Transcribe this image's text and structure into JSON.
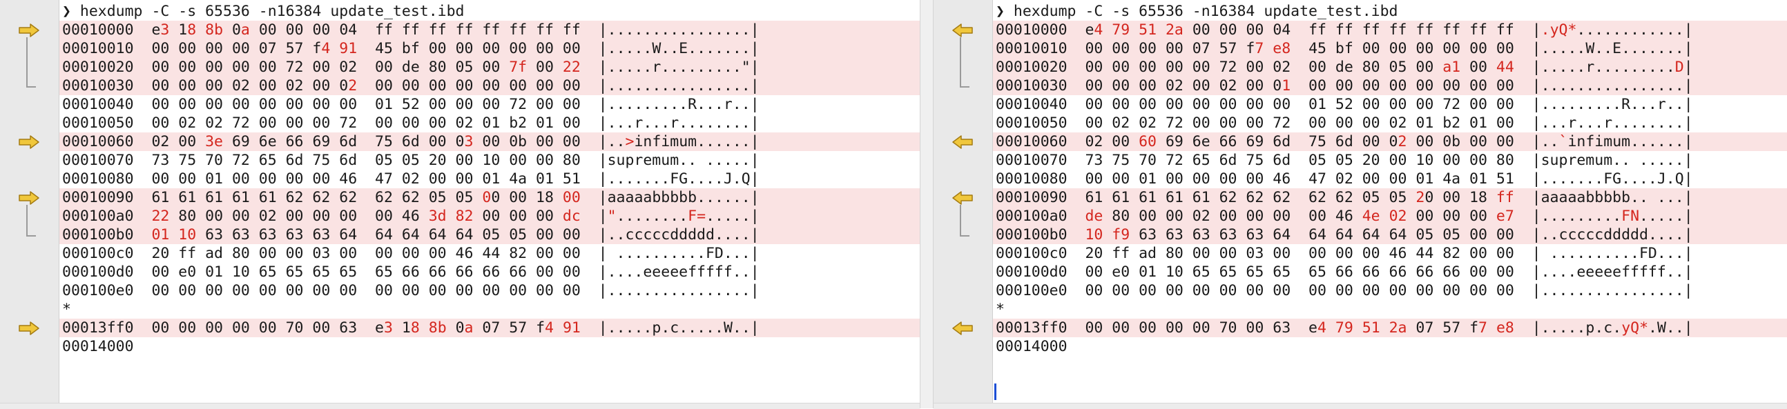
{
  "colors": {
    "diff_text": "#d4261e",
    "diff_row_bg": "#fae3e3",
    "arrow_fill": "#f0c73c",
    "arrow_stroke": "#a47b12",
    "gutter_bg": "#e9e9e9"
  },
  "left": {
    "command": "❯ hexdump -C -s 65536 -n16384 update_test.ibd",
    "rows": [
      {
        "hl": true,
        "segs": [
          [
            "00010000  e",
            0
          ],
          [
            "3",
            1
          ],
          [
            " 1",
            0
          ],
          [
            "8",
            1
          ],
          [
            " ",
            0
          ],
          [
            "8b",
            1
          ],
          [
            " 0",
            0
          ],
          [
            "a",
            1
          ],
          [
            " 00 00 00 04  ff ff ff ff ff ff ff ff  |................|",
            0
          ]
        ]
      },
      {
        "hl": true,
        "segs": [
          [
            "00010010  00 00 00 00 07 57 f",
            0
          ],
          [
            "4",
            1
          ],
          [
            " ",
            0
          ],
          [
            "91",
            1
          ],
          [
            "  45 bf 00 00 00 00 00 00  |.....W..E.......|",
            0
          ]
        ]
      },
      {
        "hl": true,
        "segs": [
          [
            "00010020  00 00 00 00 00 72 00 02  00 de 80 05 00 ",
            0
          ],
          [
            "7f",
            1
          ],
          [
            " 00 ",
            0
          ],
          [
            "22",
            1
          ],
          [
            "  |.....r.........\"|",
            0
          ]
        ]
      },
      {
        "hl": true,
        "segs": [
          [
            "00010030  00 00 00 02 00 02 00 0",
            0
          ],
          [
            "2",
            1
          ],
          [
            "  00 00 00 00 00 00 00 00  |................|",
            0
          ]
        ]
      },
      {
        "hl": false,
        "segs": [
          [
            "00010040  00 00 00 00 00 00 00 00  01 52 00 00 00 72 00 00  |.........R...r..|",
            0
          ]
        ]
      },
      {
        "hl": false,
        "segs": [
          [
            "00010050  00 02 02 72 00 00 00 72  00 00 00 02 01 b2 01 00  |...r...r........|",
            0
          ]
        ]
      },
      {
        "hl": true,
        "segs": [
          [
            "00010060  02 00 ",
            0
          ],
          [
            "3e",
            1
          ],
          [
            " 69 6e 66 69 6d  75 6d 00 0",
            0
          ],
          [
            "3",
            1
          ],
          [
            " 00 0b 00 00  |..",
            0
          ],
          [
            ">",
            1
          ],
          [
            "infimum......|",
            0
          ]
        ]
      },
      {
        "hl": false,
        "segs": [
          [
            "00010070  73 75 70 72 65 6d 75 6d  05 05 20 00 10 00 00 80  |supremum.. .....|",
            0
          ]
        ]
      },
      {
        "hl": false,
        "segs": [
          [
            "00010080  00 00 01 00 00 00 00 46  47 02 00 00 01 4a 01 51  |.......FG....J.Q|",
            0
          ]
        ]
      },
      {
        "hl": true,
        "segs": [
          [
            "00010090  61 61 61 61 61 62 62 62  62 62 05 05 ",
            0
          ],
          [
            "0",
            1
          ],
          [
            "0 00 18 ",
            0
          ],
          [
            "00",
            1
          ],
          [
            "  |aaaaabbbbb......|",
            0
          ]
        ]
      },
      {
        "hl": true,
        "segs": [
          [
            "000100a0  ",
            0
          ],
          [
            "22",
            1
          ],
          [
            " 80 00 00 02 00 00 00  00 46 ",
            0
          ],
          [
            "3d",
            1
          ],
          [
            " ",
            0
          ],
          [
            "82",
            1
          ],
          [
            " 00 00 00 ",
            0
          ],
          [
            "dc",
            1
          ],
          [
            "  |",
            0
          ],
          [
            "\"",
            1
          ],
          [
            "........",
            0
          ],
          [
            "F=",
            1
          ],
          [
            ".....|",
            0
          ]
        ]
      },
      {
        "hl": true,
        "segs": [
          [
            "000100b0  ",
            0
          ],
          [
            "01",
            1
          ],
          [
            " ",
            0
          ],
          [
            "10",
            1
          ],
          [
            " 63 63 63 63 63 64  64 64 64 64 05 05 00 00  |..cccccddddd....|",
            0
          ]
        ]
      },
      {
        "hl": false,
        "segs": [
          [
            "000100c0  20 ff ad 80 00 00 03 00  00 00 00 46 44 82 00 00  | ..........FD...|",
            0
          ]
        ]
      },
      {
        "hl": false,
        "segs": [
          [
            "000100d0  00 e0 01 10 65 65 65 65  65 66 66 66 66 66 00 00  |....eeeeefffff..|",
            0
          ]
        ]
      },
      {
        "hl": false,
        "segs": [
          [
            "000100e0  00 00 00 00 00 00 00 00  00 00 00 00 00 00 00 00  |................|",
            0
          ]
        ]
      },
      {
        "hl": false,
        "segs": [
          [
            "*",
            0
          ]
        ]
      },
      {
        "hl": true,
        "segs": [
          [
            "00013ff0  00 00 00 00 00 70 00 63  e",
            0
          ],
          [
            "3",
            1
          ],
          [
            " 1",
            0
          ],
          [
            "8",
            1
          ],
          [
            " ",
            0
          ],
          [
            "8b",
            1
          ],
          [
            " 0",
            0
          ],
          [
            "a",
            1
          ],
          [
            " 07 57 f",
            0
          ],
          [
            "4",
            1
          ],
          [
            " ",
            0
          ],
          [
            "91",
            1
          ],
          [
            "  |.....p.c.....W..|",
            0
          ]
        ]
      },
      {
        "hl": false,
        "segs": [
          [
            "00014000",
            0
          ]
        ]
      }
    ]
  },
  "right": {
    "command": "❯ hexdump -C -s 65536 -n16384 update_test.ibd",
    "rows": [
      {
        "hl": true,
        "segs": [
          [
            "00010000  e",
            0
          ],
          [
            "4",
            1
          ],
          [
            " ",
            0
          ],
          [
            "79",
            1
          ],
          [
            " ",
            0
          ],
          [
            "51",
            1
          ],
          [
            " ",
            0
          ],
          [
            "2a",
            1
          ],
          [
            " 00 00 00 04  ff ff ff ff ff ff ff ff  |",
            0
          ],
          [
            ".yQ*",
            1
          ],
          [
            "............|",
            0
          ]
        ]
      },
      {
        "hl": true,
        "segs": [
          [
            "00010010  00 00 00 00 07 57 f",
            0
          ],
          [
            "7",
            1
          ],
          [
            " ",
            0
          ],
          [
            "e8",
            1
          ],
          [
            "  45 bf 00 00 00 00 00 00  |.....W..E.......|",
            0
          ]
        ]
      },
      {
        "hl": true,
        "segs": [
          [
            "00010020  00 00 00 00 00 72 00 02  00 de 80 05 00 ",
            0
          ],
          [
            "a1",
            1
          ],
          [
            " 00 ",
            0
          ],
          [
            "44",
            1
          ],
          [
            "  |.....r.........",
            0
          ],
          [
            "D",
            1
          ],
          [
            "|",
            0
          ]
        ]
      },
      {
        "hl": true,
        "segs": [
          [
            "00010030  00 00 00 02 00 02 00 0",
            0
          ],
          [
            "1",
            1
          ],
          [
            "  00 00 00 00 00 00 00 00  |................|",
            0
          ]
        ]
      },
      {
        "hl": false,
        "segs": [
          [
            "00010040  00 00 00 00 00 00 00 00  01 52 00 00 00 72 00 00  |.........R...r..|",
            0
          ]
        ]
      },
      {
        "hl": false,
        "segs": [
          [
            "00010050  00 02 02 72 00 00 00 72  00 00 00 02 01 b2 01 00  |...r...r........|",
            0
          ]
        ]
      },
      {
        "hl": true,
        "segs": [
          [
            "00010060  02 00 ",
            0
          ],
          [
            "60",
            1
          ],
          [
            " 69 6e 66 69 6d  75 6d 00 0",
            0
          ],
          [
            "2",
            1
          ],
          [
            " 00 0b 00 00  |..",
            0
          ],
          [
            "`",
            1
          ],
          [
            "infimum......|",
            0
          ]
        ]
      },
      {
        "hl": false,
        "segs": [
          [
            "00010070  73 75 70 72 65 6d 75 6d  05 05 20 00 10 00 00 80  |supremum.. .....|",
            0
          ]
        ]
      },
      {
        "hl": false,
        "segs": [
          [
            "00010080  00 00 01 00 00 00 00 46  47 02 00 00 01 4a 01 51  |.......FG....J.Q|",
            0
          ]
        ]
      },
      {
        "hl": true,
        "segs": [
          [
            "00010090  61 61 61 61 61 62 62 62  62 62 05 05 ",
            0
          ],
          [
            "2",
            1
          ],
          [
            "0 00 18 ",
            0
          ],
          [
            "ff",
            1
          ],
          [
            "  |aaaaabbbbb.. ...|",
            0
          ]
        ]
      },
      {
        "hl": true,
        "segs": [
          [
            "000100a0  ",
            0
          ],
          [
            "de",
            1
          ],
          [
            " 80 00 00 02 00 00 00  00 46 ",
            0
          ],
          [
            "4e",
            1
          ],
          [
            " ",
            0
          ],
          [
            "02",
            1
          ],
          [
            " 00 00 00 ",
            0
          ],
          [
            "e7",
            1
          ],
          [
            "  |.........",
            0
          ],
          [
            "FN",
            1
          ],
          [
            ".....|",
            0
          ]
        ]
      },
      {
        "hl": true,
        "segs": [
          [
            "000100b0  ",
            0
          ],
          [
            "10",
            1
          ],
          [
            " ",
            0
          ],
          [
            "f9",
            1
          ],
          [
            " 63 63 63 63 63 64  64 64 64 64 05 05 00 00  |..cccccddddd....|",
            0
          ]
        ]
      },
      {
        "hl": false,
        "segs": [
          [
            "000100c0  20 ff ad 80 00 00 03 00  00 00 00 46 44 82 00 00  | ..........FD...|",
            0
          ]
        ]
      },
      {
        "hl": false,
        "segs": [
          [
            "000100d0  00 e0 01 10 65 65 65 65  65 66 66 66 66 66 00 00  |....eeeeefffff..|",
            0
          ]
        ]
      },
      {
        "hl": false,
        "segs": [
          [
            "000100e0  00 00 00 00 00 00 00 00  00 00 00 00 00 00 00 00  |................|",
            0
          ]
        ]
      },
      {
        "hl": false,
        "segs": [
          [
            "*",
            0
          ]
        ]
      },
      {
        "hl": true,
        "segs": [
          [
            "00013ff0  00 00 00 00 00 70 00 63  e",
            0
          ],
          [
            "4",
            1
          ],
          [
            " ",
            0
          ],
          [
            "79",
            1
          ],
          [
            " ",
            0
          ],
          [
            "51",
            1
          ],
          [
            " ",
            0
          ],
          [
            "2a",
            1
          ],
          [
            " 07 57 f",
            0
          ],
          [
            "7",
            1
          ],
          [
            " ",
            0
          ],
          [
            "e8",
            1
          ],
          [
            "  |.....p.c.",
            0
          ],
          [
            "yQ*",
            1
          ],
          [
            ".W..|",
            0
          ]
        ]
      },
      {
        "hl": false,
        "segs": [
          [
            "00014000",
            0
          ]
        ]
      }
    ]
  },
  "gutter": {
    "left_arrow_rows": [
      1,
      7,
      10,
      17
    ],
    "right_arrow_rows": [
      1,
      7,
      10,
      17
    ],
    "left_arrow_icon": "arrow-right-icon",
    "right_arrow_icon": "arrow-left-icon"
  }
}
